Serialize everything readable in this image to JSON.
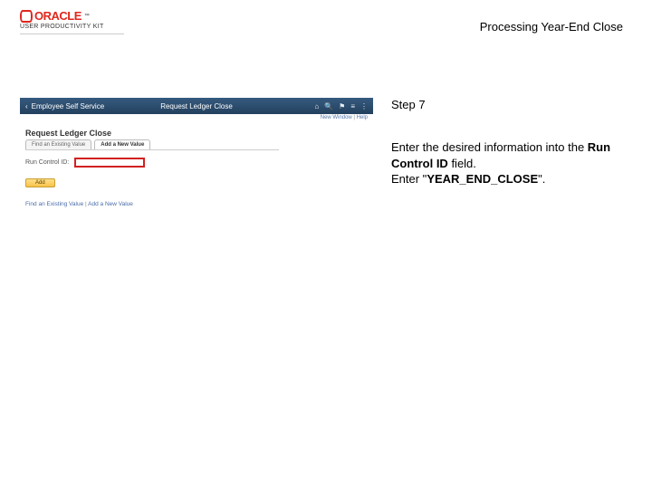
{
  "brand": {
    "name": "ORACLE",
    "kit": "USER PRODUCTIVITY KIT",
    "tm": "™"
  },
  "doc": {
    "title": "Processing Year-End Close"
  },
  "step": {
    "label": "Step 7"
  },
  "instruction": {
    "line1_a": "Enter the desired information into the ",
    "line1_bold": "Run Control ID",
    "line1_b": " field.",
    "line2_a": "Enter \"",
    "line2_bold": "YEAR_END_CLOSE",
    "line2_b": "\"."
  },
  "app": {
    "nav": {
      "back_label": "Employee Self Service",
      "title": "Request Ledger Close",
      "icons": {
        "home": "⌂",
        "search": "🔍",
        "flag": "⚑",
        "nav": "≡",
        "menu": "⋮"
      }
    },
    "sub": {
      "new_window": "New Window",
      "help": "Help",
      "sep": " | "
    },
    "heading": "Request Ledger Close",
    "tabs": {
      "t1": "Find an Existing Value",
      "t2": "Add a New Value"
    },
    "field": {
      "label": "Run Control ID:"
    },
    "add_button": "Add",
    "footer": {
      "f1": "Find an Existing Value",
      "sep": " | ",
      "f2": "Add a New Value"
    }
  }
}
